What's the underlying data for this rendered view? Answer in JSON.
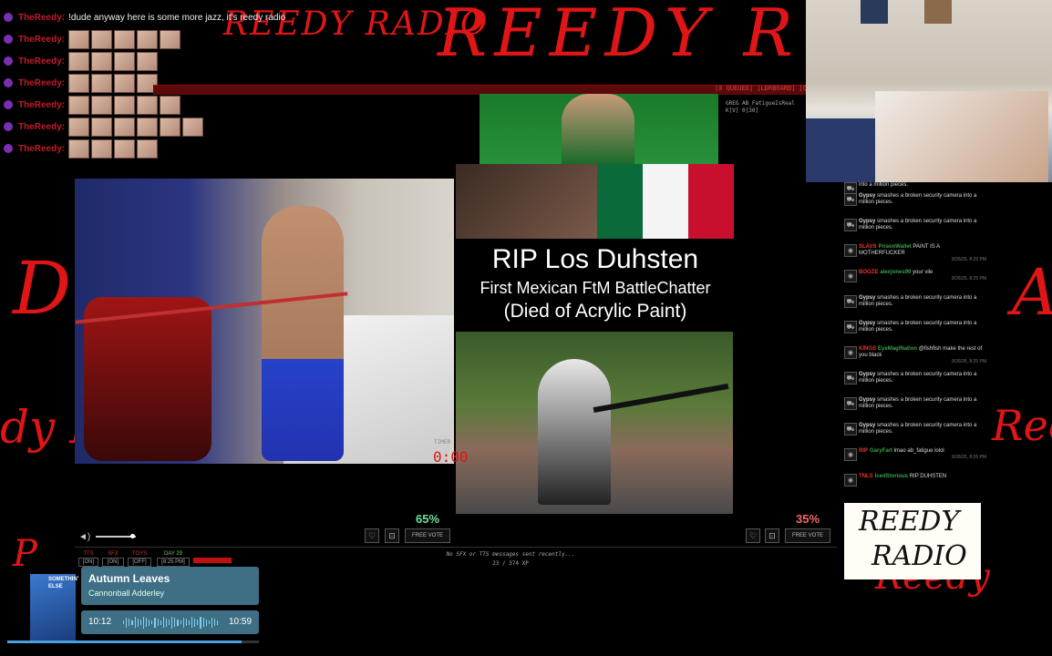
{
  "chat": {
    "lines": [
      {
        "name": "TheReedy:",
        "message": "!dude anyway here is some more jazz, it's reedy radio",
        "emotes": 0
      },
      {
        "name": "TheReedy:",
        "message": "",
        "emotes": 5
      },
      {
        "name": "TheReedy:",
        "message": "",
        "emotes": 4
      },
      {
        "name": "TheReedy:",
        "message": "",
        "emotes": 4
      },
      {
        "name": "TheReedy:",
        "message": "",
        "emotes": 5
      },
      {
        "name": "TheReedy:",
        "message": "",
        "emotes": 6
      },
      {
        "name": "TheReedy:",
        "message": "",
        "emotes": 4
      }
    ]
  },
  "background": {
    "scrawl_top": "REEDY RADIO",
    "scrawl_main": "REEDY R"
  },
  "topbar": {
    "labels": "[0 QUEUED]  [LDRBOARD]  [QUE"
  },
  "overlay_small": {
    "line1": "GREG AB_FatigueIsReal",
    "line2": "K[V] 0[30]"
  },
  "poster": {
    "title": "RIP Los Duhsten",
    "subtitle1": "First Mexican FtM BattleChatter",
    "subtitle2": "(Died of Acrylic Paint)"
  },
  "timer": {
    "label": "TIMER",
    "value": "0:00"
  },
  "vote": {
    "left_pct": "65%",
    "right_pct": "35%",
    "left_button": "FREE VOTE",
    "right_button": "FREE VOTE",
    "left_color": "#6fe0a0",
    "right_color": "#f06a6a"
  },
  "volume": {
    "level": 0.9
  },
  "status": {
    "tts_label": "TTS",
    "tts_value": "[ON]",
    "sfx_label": "SFX",
    "sfx_value": "[ON]",
    "toys_label": "TOYS",
    "toys_value": "[OFF]",
    "day_label": "DAY 29",
    "day_time": "[8:25 PM]",
    "center_line1": "No SFX or TTS messages sent recently...",
    "center_line2": "23 / 374 XP"
  },
  "sidechat": {
    "rows": [
      {
        "type": "action",
        "text": "into a million pieces."
      },
      {
        "type": "action",
        "name": "Gypsy",
        "text": "smashes a broken security camera into a million pieces."
      },
      {
        "type": "action",
        "name": "Gypsy",
        "text": "smashes a broken security camera into a million pieces."
      },
      {
        "type": "msg",
        "badge": "SLAVS",
        "name": "PrisonWallet",
        "text": "PAINT IS A MOTHERFUCKER",
        "time": "9/26/25, 8:25 PM"
      },
      {
        "type": "msg",
        "badge": "BOOZE",
        "name": "alexjones99",
        "text": "your vile",
        "time": "9/26/25, 8:25 PM"
      },
      {
        "type": "action",
        "name": "Gypsy",
        "text": "smashes a broken security camera into a million pieces."
      },
      {
        "type": "action",
        "name": "Gypsy",
        "text": "smashes a broken security camera into a million pieces."
      },
      {
        "type": "msg",
        "badge": "KINGS",
        "name": "EyeMagiNation",
        "text": "@fishfish make the rest of you black",
        "time": "9/26/25, 8:25 PM"
      },
      {
        "type": "action",
        "name": "Gypsy",
        "text": "smashes a broken security camera into a million pieces."
      },
      {
        "type": "action",
        "name": "Gypsy",
        "text": "smashes a broken security camera into a million pieces."
      },
      {
        "type": "action",
        "name": "Gypsy",
        "text": "smashes a broken security camera into a million pieces."
      },
      {
        "type": "msg",
        "badge": "RIP",
        "name": "GaryFart",
        "text": "lmao ab_fatigue lolol",
        "time": "9/26/25, 8:26 PM"
      },
      {
        "type": "msg",
        "badge": "TNLS",
        "name": "IcedStorious",
        "text": "RIP DUHSTEN",
        "time": ""
      }
    ]
  },
  "logo": {
    "line1": "REEDY",
    "line2": "RADIO"
  },
  "now_playing": {
    "album_text": "SOMETHIN' ELSE",
    "title": "Autumn Leaves",
    "artist": "Cannonball Adderley",
    "elapsed": "10:12",
    "duration": "10:59",
    "progress": 0.93
  }
}
